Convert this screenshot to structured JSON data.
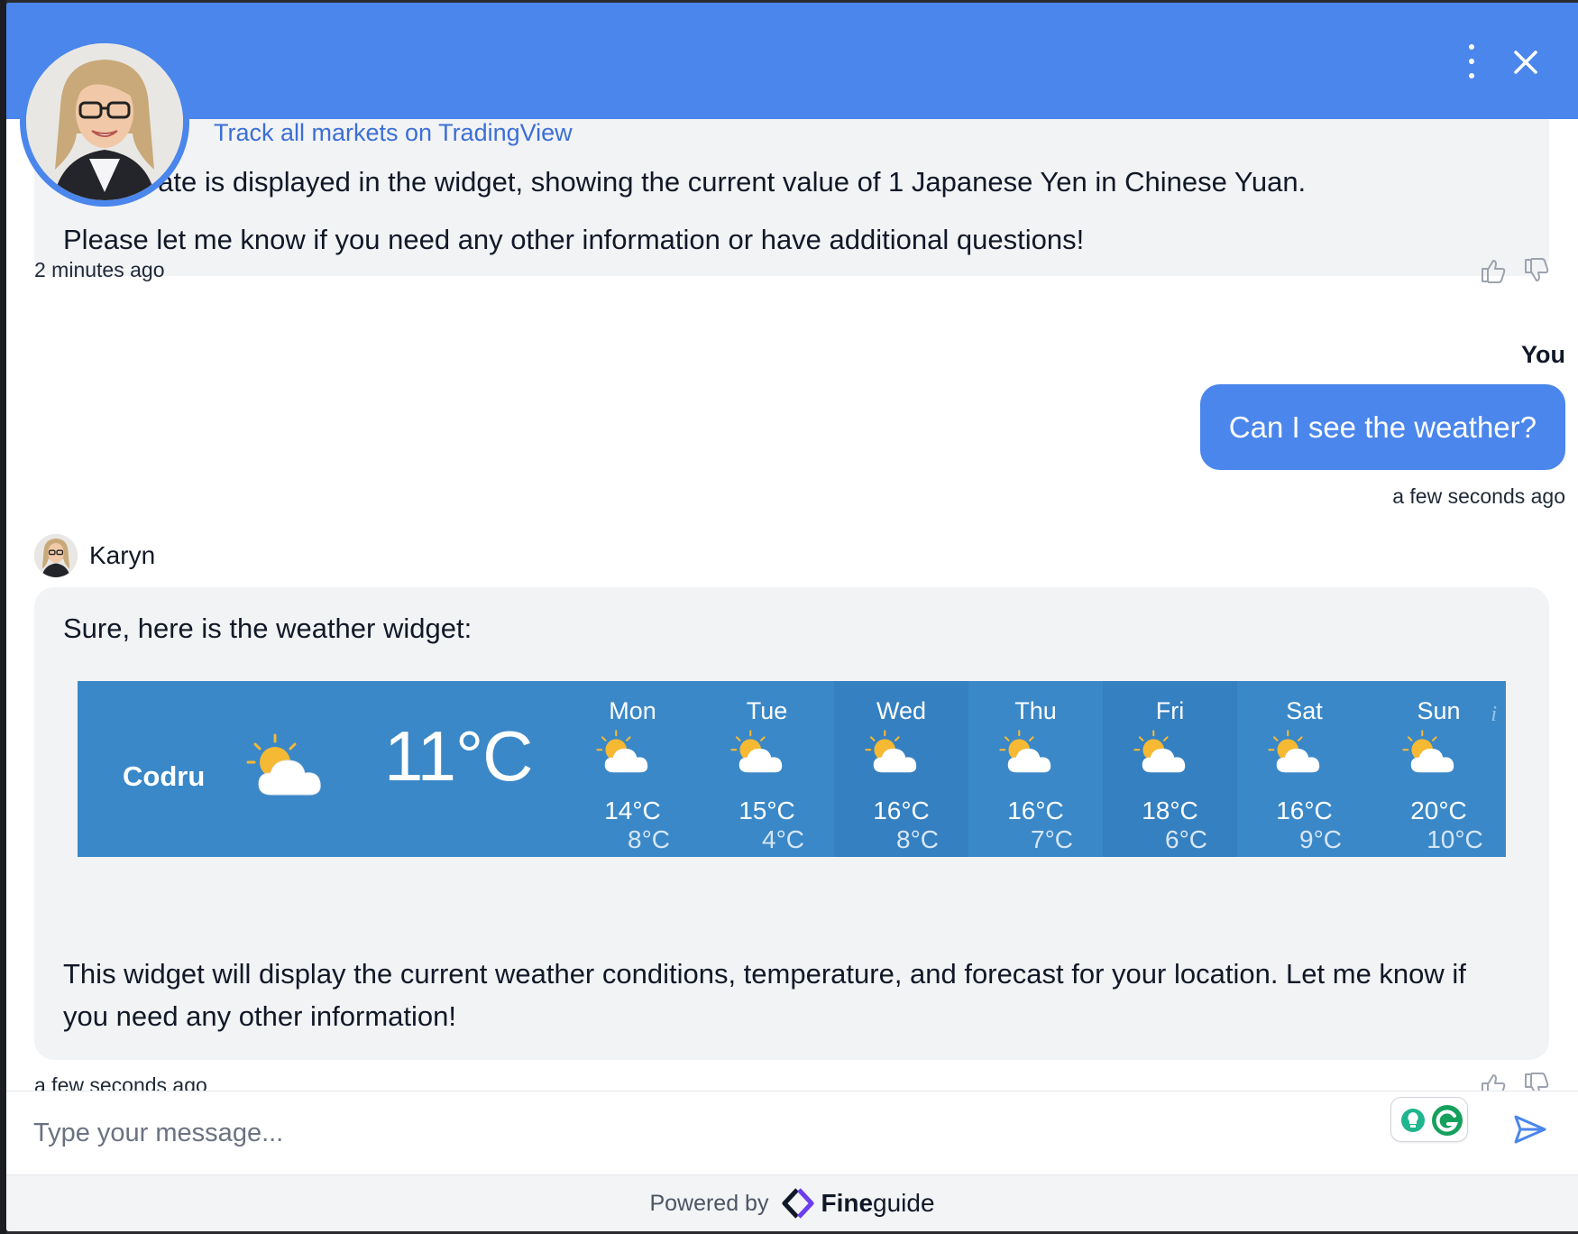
{
  "header": {
    "menu_icon": "more-vertical-icon",
    "close_icon": "close-icon"
  },
  "messages": {
    "prev": {
      "link_text": "Track all markets on TradingView",
      "line1": "hange rate is displayed in the widget, showing the current value of 1 Japanese Yen in Chinese Yuan.",
      "line2": "Please let me know if you need any other information or have additional questions!",
      "time": "2 minutes ago"
    },
    "user": {
      "name": "You",
      "text": "Can I see the weather?",
      "time": "a few seconds ago"
    },
    "bot": {
      "name": "Karyn",
      "intro": "Sure, here is the weather widget:",
      "outro": "This widget will display the current weather conditions, temperature, and forecast for your location. Let me know if you need any other information!",
      "time": "a few seconds ago"
    }
  },
  "weather": {
    "city": "Codru",
    "current_temp": "11°C",
    "condition_icon": "partly-cloudy-icon",
    "info_label": "i",
    "days": [
      {
        "name": "Mon",
        "hi": "14°C",
        "lo": "8°C"
      },
      {
        "name": "Tue",
        "hi": "15°C",
        "lo": "4°C"
      },
      {
        "name": "Wed",
        "hi": "16°C",
        "lo": "8°C"
      },
      {
        "name": "Thu",
        "hi": "16°C",
        "lo": "7°C"
      },
      {
        "name": "Fri",
        "hi": "18°C",
        "lo": "6°C"
      },
      {
        "name": "Sat",
        "hi": "16°C",
        "lo": "9°C"
      },
      {
        "name": "Sun",
        "hi": "20°C",
        "lo": "10°C"
      }
    ]
  },
  "composer": {
    "placeholder": "Type your message..."
  },
  "footer": {
    "powered_by": "Powered by",
    "brand_bold": "Fine",
    "brand_rest": "guide"
  },
  "colors": {
    "header": "#4a86ec",
    "user_bubble": "#4a86ec",
    "bot_bubble": "#f2f3f5",
    "weather_bg": "#3a88c8"
  }
}
